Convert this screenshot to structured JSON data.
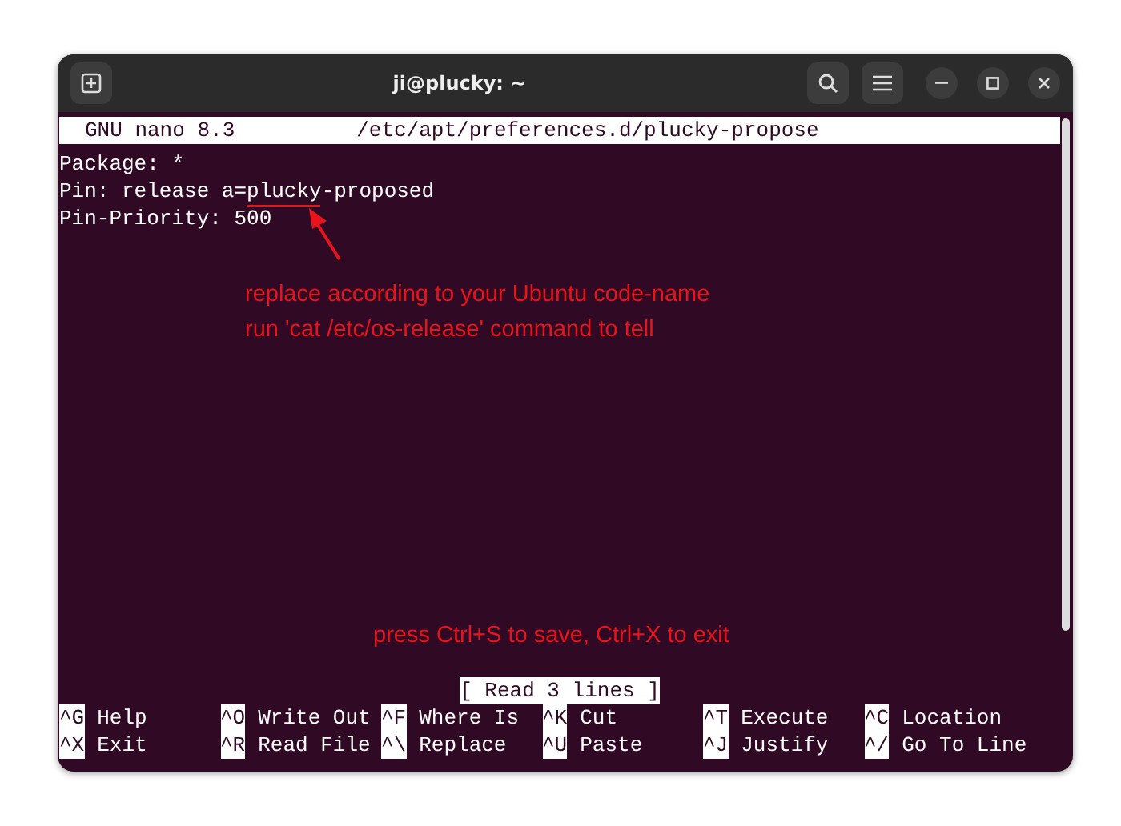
{
  "window": {
    "title": "ji@plucky: ~"
  },
  "nano": {
    "version": "GNU nano 8.3",
    "filename": "/etc/apt/preferences.d/plucky-propose"
  },
  "lines": [
    "Package: *",
    "Pin: release a=plucky-proposed",
    "Pin-Priority: 500"
  ],
  "annotations": [
    {
      "kind": "note",
      "lines": [
        "replace according to your Ubuntu code-name",
        "run 'cat /etc/os-release' command to tell"
      ]
    },
    {
      "kind": "footer",
      "lines": [
        "press Ctrl+S to save, Ctrl+X to exit"
      ]
    }
  ],
  "status": "[ Read 3 lines ]",
  "shortcuts": [
    [
      {
        "key": "^G",
        "label": "Help"
      },
      {
        "key": "^X",
        "label": "Exit"
      }
    ],
    [
      {
        "key": "^O",
        "label": "Write Out"
      },
      {
        "key": "^R",
        "label": "Read File"
      }
    ],
    [
      {
        "key": "^F",
        "label": "Where Is"
      },
      {
        "key": "^\\",
        "label": "Replace"
      }
    ],
    [
      {
        "key": "^K",
        "label": "Cut"
      },
      {
        "key": "^U",
        "label": "Paste"
      }
    ],
    [
      {
        "key": "^T",
        "label": "Execute"
      },
      {
        "key": "^J",
        "label": "Justify"
      }
    ],
    [
      {
        "key": "^C",
        "label": "Location"
      },
      {
        "key": "^/",
        "label": "Go To Line"
      }
    ]
  ]
}
